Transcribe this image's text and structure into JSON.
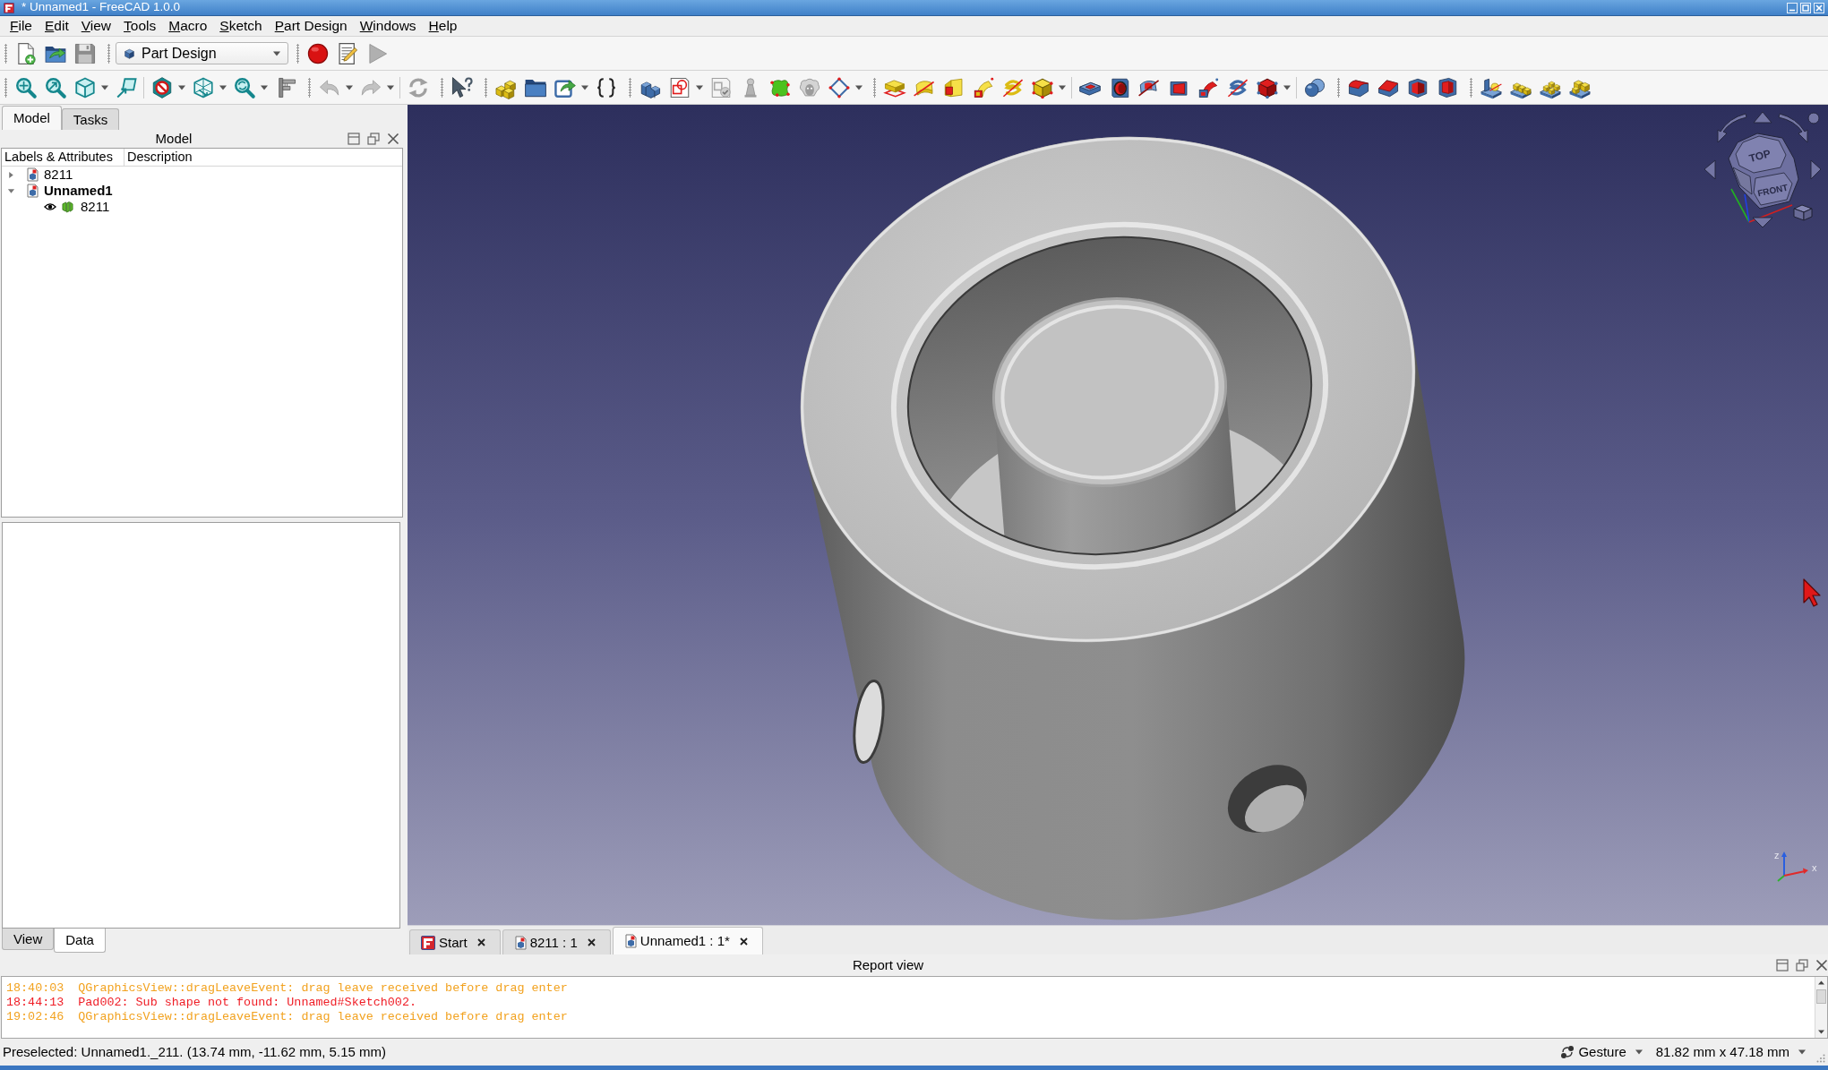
{
  "window": {
    "title": "* Unnamed1 - FreeCAD 1.0.0"
  },
  "menu": [
    "File",
    "Edit",
    "View",
    "Tools",
    "Macro",
    "Sketch",
    "Part Design",
    "Windows",
    "Help"
  ],
  "toolbar": {
    "workbench": "Part Design"
  },
  "left_panel": {
    "tabs": [
      {
        "label": "Model",
        "selected": true
      },
      {
        "label": "Tasks",
        "selected": false
      }
    ],
    "title": "Model",
    "tree": {
      "columns": [
        "Labels & Attributes",
        "Description"
      ],
      "items": [
        {
          "label": "8211",
          "expanded": false,
          "active": false
        },
        {
          "label": "Unnamed1",
          "expanded": true,
          "active": true,
          "children": [
            {
              "label": "8211",
              "visible": true
            }
          ]
        }
      ]
    },
    "property_tabs": [
      {
        "label": "View",
        "selected": false
      },
      {
        "label": "Data",
        "selected": true
      }
    ]
  },
  "viewport": {
    "nav_cube": {
      "faces": [
        "TOP",
        "FRONT"
      ]
    },
    "axes": [
      "z",
      "x"
    ]
  },
  "document_tabs": [
    {
      "label": "Start",
      "kind": "start",
      "selected": false
    },
    {
      "label": "8211 : 1",
      "kind": "document",
      "selected": false
    },
    {
      "label": "Unnamed1 : 1*",
      "kind": "document",
      "selected": true
    }
  ],
  "report_view": {
    "title": "Report view",
    "lines": [
      {
        "time": "18:40:03",
        "message": "QGraphicsView::dragLeaveEvent: drag leave received before drag enter",
        "kind": "warning"
      },
      {
        "time": "18:44:13",
        "message": "Pad002: Sub shape not found: Unnamed#Sketch002.",
        "kind": "error"
      },
      {
        "time": "19:02:46",
        "message": "QGraphicsView::dragLeaveEvent: drag leave received before drag enter",
        "kind": "warning"
      }
    ]
  },
  "status_bar": {
    "message": "Preselected: Unnamed1._211. (13.74 mm, -11.62 mm, 5.15 mm)",
    "navigation": "Gesture",
    "dimensions": "81.82 mm x 47.18 mm"
  }
}
